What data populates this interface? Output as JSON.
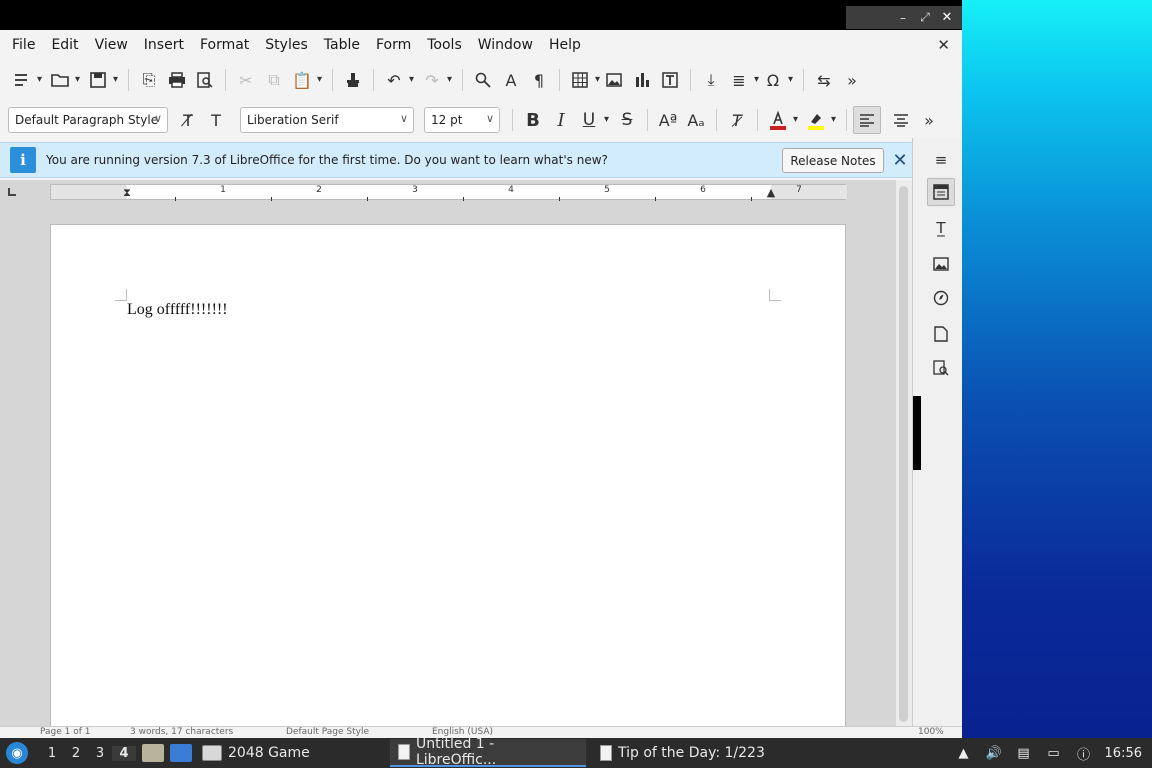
{
  "window_controls": {
    "minimize": "–",
    "maximize": "⤢",
    "close": "✕"
  },
  "menubar": {
    "items": [
      "File",
      "Edit",
      "View",
      "Insert",
      "Format",
      "Styles",
      "Table",
      "Form",
      "Tools",
      "Window",
      "Help"
    ],
    "close_document": "✕"
  },
  "formatting": {
    "paragraph_style": "Default Paragraph Style",
    "font_name": "Liberation Serif",
    "font_size": "12 pt",
    "font_color": "#c9211e",
    "highlight_color": "#ffff00"
  },
  "infobar": {
    "message": "You are running version 7.3 of LibreOffice for the first time. Do you want to learn what's new?",
    "release_notes_label": "Release Notes",
    "close": "✕"
  },
  "ruler": {
    "numbers": [
      "1",
      "2",
      "3",
      "4",
      "5",
      "6",
      "7"
    ]
  },
  "document": {
    "text": "Log offfff!!!!!!!"
  },
  "statusbar": {
    "page": "Page 1 of 1",
    "words": "3 words, 17 characters",
    "page_style": "Default Page Style",
    "language": "English (USA)",
    "zoom": "100%"
  },
  "taskbar": {
    "workspaces": [
      "1",
      "2",
      "3",
      "4"
    ],
    "active_workspace": "4",
    "tasks": [
      {
        "label": "2048 Game"
      },
      {
        "label": "Untitled 1 - LibreOffic..."
      },
      {
        "label": "Tip of the Day: 1/223"
      }
    ],
    "clock": "16:56"
  }
}
